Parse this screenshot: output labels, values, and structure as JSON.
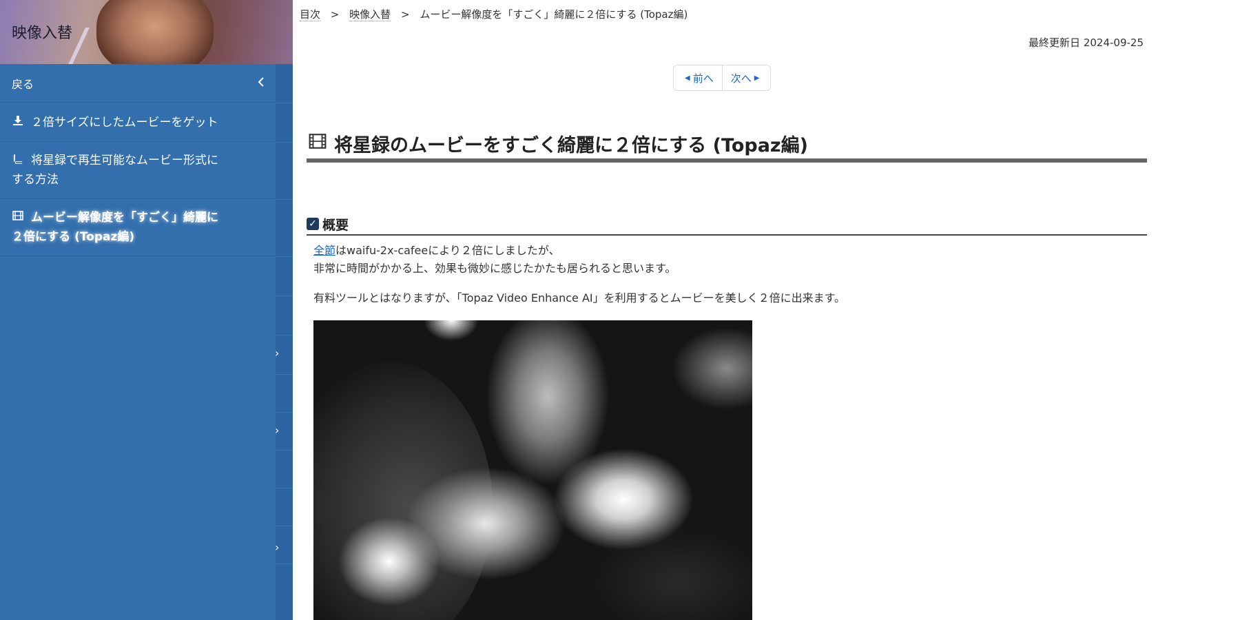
{
  "sidebar": {
    "site_title": "映像入替",
    "back_label": "戻る",
    "items": [
      {
        "icon": "download-icon",
        "label": "２倍サイズにしたムービーをゲット"
      },
      {
        "icon": "book-icon",
        "label_line1": "将星録で再生可能なムービー形式に",
        "label_line2": "する方法"
      },
      {
        "icon": "film-icon",
        "label_line1": "ムービー解像度を「すごく」綺麗に",
        "label_line2": "２倍にする (Topaz編)",
        "active": true
      }
    ],
    "colors": {
      "background": "#336fad",
      "rail": "#2d64a2"
    }
  },
  "breadcrumb": {
    "items": [
      "目次",
      "映像入替"
    ],
    "current": "ムービー解像度を「すごく」綺麗に２倍にする (Topaz編)",
    "separator": ">"
  },
  "last_updated": "最終更新日 2024-09-25",
  "pager": {
    "prev": "前へ",
    "next": "次へ"
  },
  "page_title": "将星録のムービーをすごく綺麗に２倍にする (Topaz編)",
  "section": {
    "heading": "概要",
    "p1_link": "全節",
    "p1_rest": "はwaifu-2x-cafeeにより２倍にしましたが、",
    "p1_line2": "非常に時間がかかる上、効果も微妙に感じたかたも居られると思います。",
    "p2": "有料ツールとはなりますが、「Topaz Video Enhance AI」を利用するとムービーを美しく２倍に出来ます。"
  },
  "colors": {
    "link": "#1a66d6",
    "title_rule": "#666666",
    "heading_check": "#1e3a5f"
  }
}
